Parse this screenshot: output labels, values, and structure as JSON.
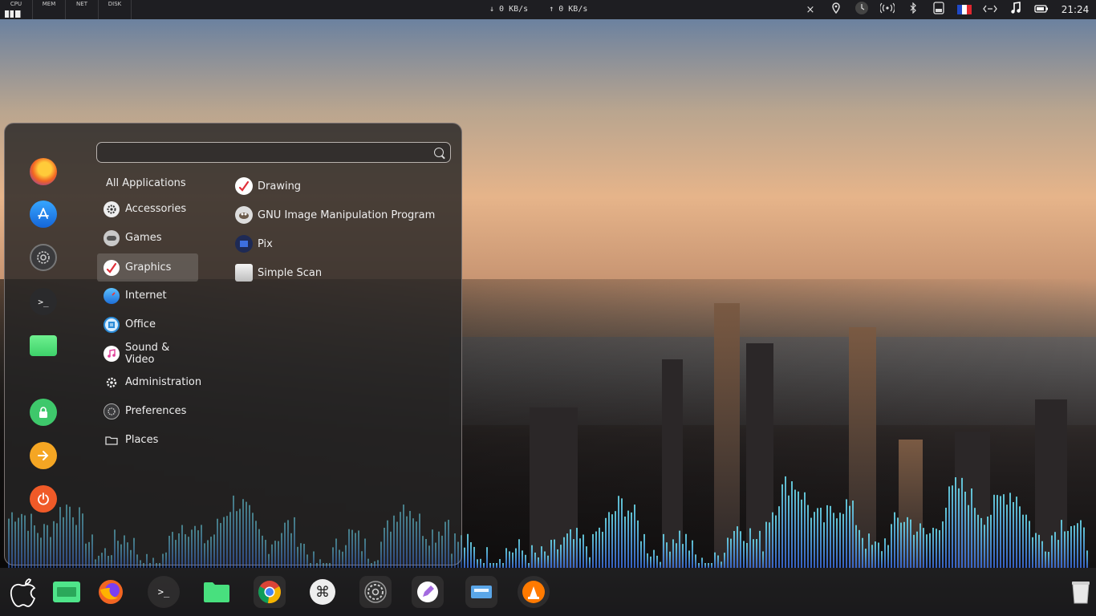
{
  "topbar": {
    "monitors": [
      "CPU",
      "MEM",
      "NET",
      "DISK"
    ],
    "net_down": "↓ 0 KB/s",
    "net_up": "↑ 0 KB/s",
    "tray_icons": [
      "close-icon",
      "location-icon",
      "clock-icon",
      "wifi-icon",
      "bluetooth-icon",
      "storage-icon",
      "flag-fr-icon",
      "network-icon",
      "music-icon",
      "battery-icon"
    ],
    "close_glyph": "×",
    "time": "21:24"
  },
  "menu": {
    "search_value": "",
    "favorites": [
      "firefox-icon",
      "app-store-icon",
      "settings-icon",
      "terminal-icon",
      "folder-icon",
      "lock-icon",
      "logout-icon",
      "power-icon"
    ],
    "categories": {
      "all": "All Applications",
      "items": [
        {
          "label": "Accessories"
        },
        {
          "label": "Games"
        },
        {
          "label": "Graphics"
        },
        {
          "label": "Internet"
        },
        {
          "label": "Office"
        },
        {
          "label": "Sound & Video"
        },
        {
          "label": "Administration"
        },
        {
          "label": "Preferences"
        },
        {
          "label": "Places"
        }
      ]
    },
    "apps": [
      {
        "label": "Drawing"
      },
      {
        "label": "GNU Image Manipulation Program"
      },
      {
        "label": "Pix"
      },
      {
        "label": "Simple Scan"
      }
    ]
  },
  "dock": {
    "items": [
      "apple-icon",
      "file-manager-icon",
      "firefox-icon",
      "terminal-icon",
      "folder-icon",
      "chrome-icon",
      "command-icon",
      "settings-icon",
      "drawing-icon",
      "scanner-icon",
      "vlc-icon",
      "trash-icon"
    ],
    "terminal_glyph": ">_",
    "command_glyph": "⌘"
  },
  "colors": {
    "accent": "#4fb3f0",
    "viz_top": "#6fe3f5",
    "viz_bottom": "#3b6de0"
  }
}
